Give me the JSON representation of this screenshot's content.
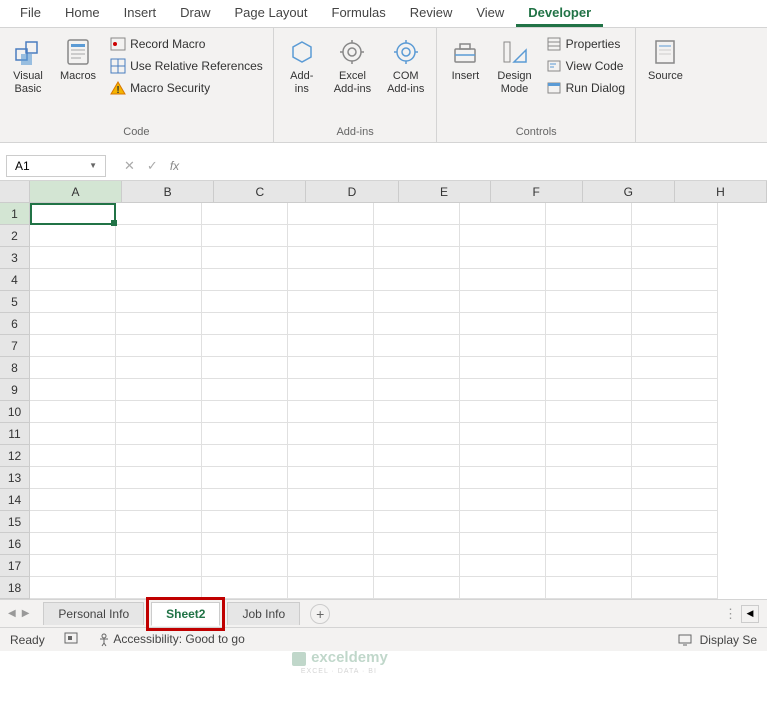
{
  "ribbon_tabs": [
    "File",
    "Home",
    "Insert",
    "Draw",
    "Page Layout",
    "Formulas",
    "Review",
    "View",
    "Developer"
  ],
  "active_tab": "Developer",
  "groups": {
    "code": {
      "label": "Code",
      "visual_basic": "Visual\nBasic",
      "macros": "Macros",
      "record_macro": "Record Macro",
      "use_relative": "Use Relative References",
      "macro_security": "Macro Security"
    },
    "addins": {
      "label": "Add-ins",
      "addins_btn": "Add-\nins",
      "excel_addins": "Excel\nAdd-ins",
      "com_addins": "COM\nAdd-ins"
    },
    "controls": {
      "label": "Controls",
      "insert": "Insert",
      "design_mode": "Design\nMode",
      "properties": "Properties",
      "view_code": "View Code",
      "run_dialog": "Run Dialog"
    },
    "source": {
      "btn": "Source"
    }
  },
  "name_box": "A1",
  "columns": [
    "A",
    "B",
    "C",
    "D",
    "E",
    "F",
    "G",
    "H"
  ],
  "rows": [
    "1",
    "2",
    "3",
    "4",
    "5",
    "6",
    "7",
    "8",
    "9",
    "10",
    "11",
    "12",
    "13",
    "14",
    "15",
    "16",
    "17",
    "18"
  ],
  "sheet_tabs": {
    "personal_info": "Personal Info",
    "sheet2": "Sheet2",
    "job_info": "Job Info"
  },
  "status": {
    "ready": "Ready",
    "accessibility": "Accessibility: Good to go",
    "display_settings": "Display Se"
  },
  "watermark": {
    "brand": "exceldemy",
    "tag": "EXCEL · DATA · BI"
  }
}
